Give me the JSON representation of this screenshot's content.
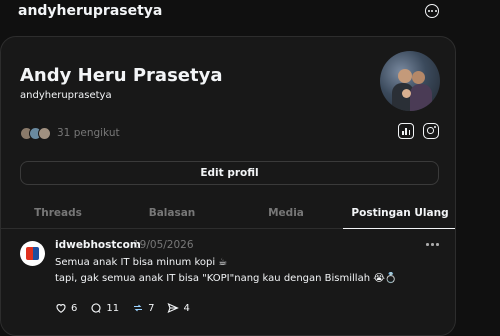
{
  "header": {
    "username": "andyheruprasetya"
  },
  "profile": {
    "name": "Andy Heru Prasetya",
    "handle": "andyheruprasetya",
    "followers_text": "31 pengikut",
    "edit_label": "Edit profil"
  },
  "tabs": [
    {
      "label": "Threads",
      "active": false
    },
    {
      "label": "Balasan",
      "active": false
    },
    {
      "label": "Media",
      "active": false
    },
    {
      "label": "Postingan Ulang",
      "active": true
    }
  ],
  "post": {
    "user": "idwebhostcom",
    "date": "19/05/2026",
    "line1": "Semua anak IT bisa minum kopi ☕",
    "line2": "tapi, gak semua anak IT bisa \"KOPI\"nang kau dengan Bismillah 😭💍",
    "likes": "6",
    "replies": "11",
    "reposts": "7",
    "shares": "4"
  },
  "icons": {
    "menu": "more-circle-icon",
    "insights": "insights-icon",
    "instagram": "instagram-icon",
    "like": "heart-icon",
    "reply": "comment-icon",
    "repost": "repost-icon",
    "share": "share-icon"
  },
  "colors": {
    "background": "#101010",
    "card": "#181818",
    "text": "#f3f5f7",
    "muted": "#777777"
  }
}
